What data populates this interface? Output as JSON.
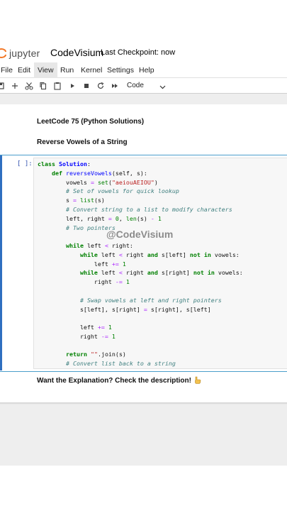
{
  "header": {
    "brand": "jupyter",
    "notebook_title": "CodeVisium",
    "checkpoint": "Last Checkpoint: now"
  },
  "menu": [
    {
      "label": "File"
    },
    {
      "label": "Edit"
    },
    {
      "label": "View",
      "active": true
    },
    {
      "label": "Run"
    },
    {
      "label": "Kernel"
    },
    {
      "label": "Settings"
    },
    {
      "label": "Help"
    }
  ],
  "toolbar": {
    "icons": [
      "save-icon",
      "add-cell-icon",
      "cut-icon",
      "copy-icon",
      "paste-icon",
      "run-icon",
      "stop-icon",
      "restart-icon",
      "fast-forward-icon"
    ],
    "cell_type": "Code"
  },
  "notebook": {
    "heading1": "LeetCode 75 (Python Solutions)",
    "heading2": "Reverse Vowels of a String",
    "prompt": "[ ]:",
    "watermark": "@CodeVisium",
    "explanation": "Want the Explanation? Check the description!"
  },
  "colors": {
    "cell_bar": "#2f6fc0",
    "keyword": "#008000",
    "comment": "#408080",
    "string": "#ba2121"
  }
}
